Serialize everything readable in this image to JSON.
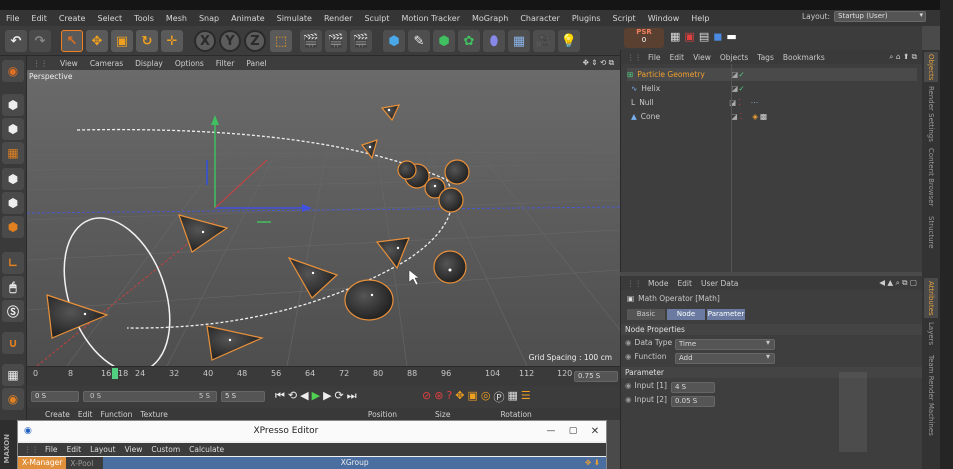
{
  "menu": [
    "File",
    "Edit",
    "Create",
    "Select",
    "Tools",
    "Mesh",
    "Snap",
    "Animate",
    "Simulate",
    "Render",
    "Sculpt",
    "Motion Tracker",
    "MoGraph",
    "Character",
    "Plugins",
    "Script",
    "Window",
    "Help"
  ],
  "layout": {
    "label": "Layout:",
    "value": "Startup (User)"
  },
  "toolbar": {
    "x": "X",
    "y": "Y",
    "z": "Z",
    "psr_label": "PSR",
    "psr_value": "0"
  },
  "viewport": {
    "menu": [
      "View",
      "Cameras",
      "Display",
      "Options",
      "Filter",
      "Panel"
    ],
    "name": "Perspective",
    "grid_spacing": "Grid Spacing : 100 cm"
  },
  "timeline": {
    "ticks": [
      "0",
      "8",
      "16",
      "18",
      "24",
      "32",
      "40",
      "48",
      "56",
      "64",
      "72",
      "80",
      "88",
      "96",
      "104",
      "112",
      "120"
    ],
    "end_field": "0.75 S"
  },
  "transport": {
    "start": "0 S",
    "range_start": "0 S",
    "range_end": "5 S",
    "end": "5 S"
  },
  "coords": {
    "menu": [
      "Create",
      "Edit",
      "Function",
      "Texture"
    ],
    "position": "Position",
    "size": "Size",
    "rotation": "Rotation"
  },
  "objects": {
    "menu": [
      "File",
      "Edit",
      "View",
      "Objects",
      "Tags",
      "Bookmarks"
    ],
    "items": [
      {
        "name": "Particle Geometry",
        "active": true
      },
      {
        "name": "Helix",
        "active": false
      },
      {
        "name": "Null",
        "active": false
      },
      {
        "name": "Cone",
        "active": false
      }
    ]
  },
  "attributes": {
    "menu": [
      "Mode",
      "Edit",
      "User Data"
    ],
    "title": "Math Operator [Math]",
    "tabs": [
      "Basic",
      "Node",
      "Parameter"
    ],
    "node_properties": "Node Properties",
    "data_type_label": "Data Type",
    "data_type_value": "Time",
    "function_label": "Function",
    "function_value": "Add",
    "parameter": "Parameter",
    "input1_label": "Input [1]",
    "input1_value": "4 S",
    "input2_label": "Input [2]",
    "input2_value": "0.05 S"
  },
  "side_tabs_top": [
    "Objects",
    "Render Settings",
    "Content Browser",
    "Structure"
  ],
  "side_tabs_bottom": [
    "Attributes",
    "Layers",
    "Team Render Machines"
  ],
  "xpresso": {
    "title": "XPresso Editor",
    "menu": [
      "File",
      "Edit",
      "Layout",
      "View",
      "Custom",
      "Calculate"
    ],
    "tab_manager": "X-Manager",
    "tab_pool": "X-Pool",
    "group": "XGroup",
    "side_label": "MAXON"
  }
}
